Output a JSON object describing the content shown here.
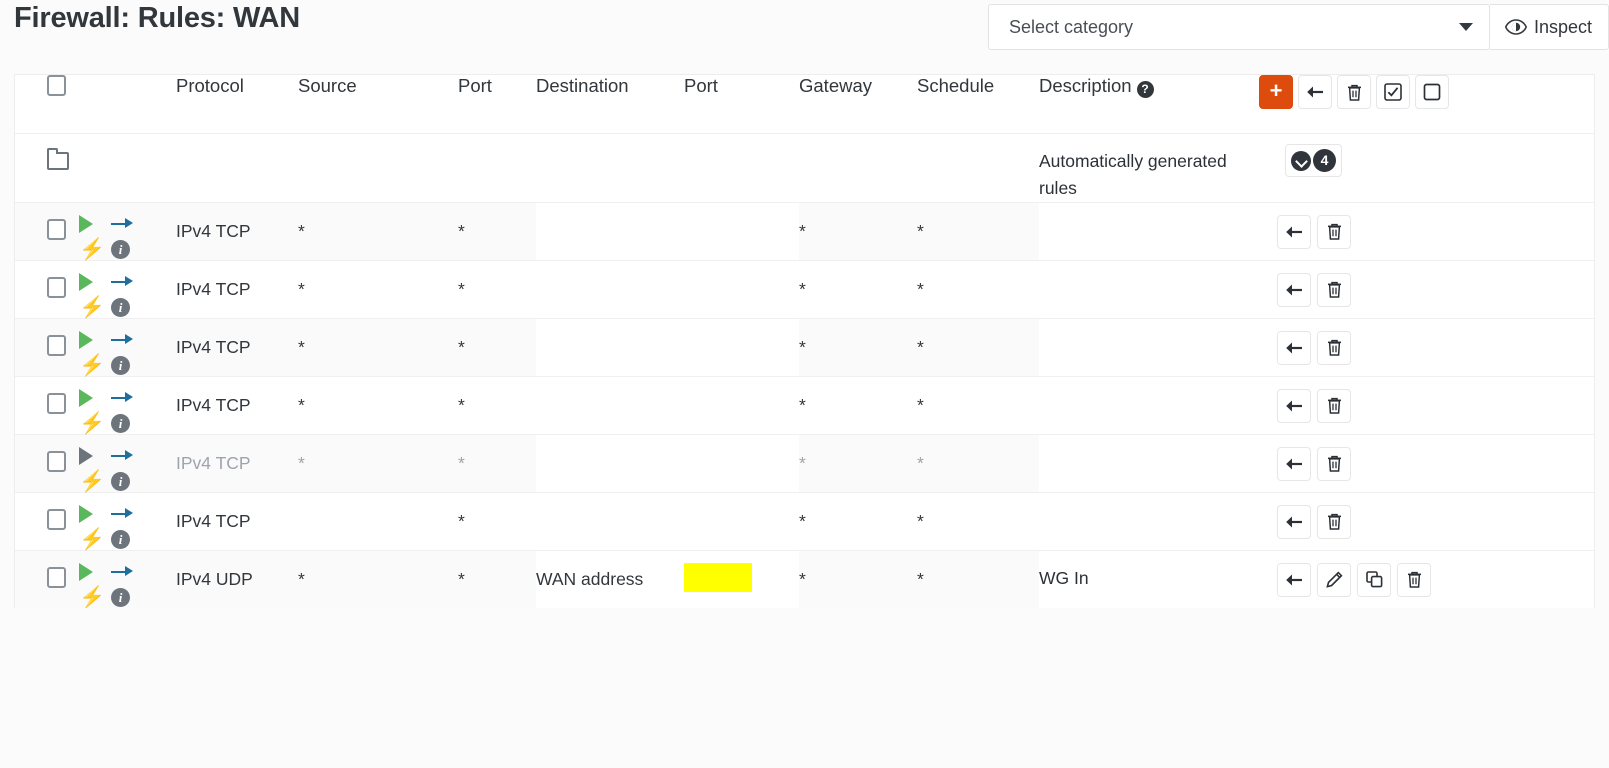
{
  "header": {
    "title": "Firewall: Rules: WAN",
    "category_select": {
      "value": "Select category",
      "placeholder": "Select category"
    },
    "inspect_button": "Inspect"
  },
  "table": {
    "columns": [
      "Protocol",
      "Source",
      "Port",
      "Destination",
      "Port",
      "Gateway",
      "Schedule",
      "Description"
    ],
    "description_help": "?",
    "header_actions": [
      {
        "name": "add-rule-button",
        "glyph": "+"
      },
      {
        "name": "move-rules-button",
        "glyph": "arrow-left"
      },
      {
        "name": "delete-rules-button",
        "glyph": "trash"
      },
      {
        "name": "select-all-button",
        "glyph": "checked-box"
      },
      {
        "name": "deselect-all-button",
        "glyph": "empty-box"
      }
    ],
    "folder_row": {
      "description": "Automatically generated rules",
      "count": "4"
    },
    "rows": [
      {
        "protocol": "IPv4 TCP",
        "source": "*",
        "src_port": "*",
        "destination": "",
        "dst_port": "",
        "gateway": "*",
        "schedule": "*",
        "description": "",
        "enabled": true,
        "highlight_dst_port": false,
        "actions": [
          "move",
          "delete"
        ]
      },
      {
        "protocol": "IPv4 TCP",
        "source": "*",
        "src_port": "*",
        "destination": "",
        "dst_port": "",
        "gateway": "*",
        "schedule": "*",
        "description": "",
        "enabled": true,
        "highlight_dst_port": false,
        "actions": [
          "move",
          "delete"
        ]
      },
      {
        "protocol": "IPv4 TCP",
        "source": "*",
        "src_port": "*",
        "destination": "",
        "dst_port": "",
        "gateway": "*",
        "schedule": "*",
        "description": "",
        "enabled": true,
        "highlight_dst_port": false,
        "actions": [
          "move",
          "delete"
        ]
      },
      {
        "protocol": "IPv4 TCP",
        "source": "*",
        "src_port": "*",
        "destination": "",
        "dst_port": "",
        "gateway": "*",
        "schedule": "*",
        "description": "",
        "enabled": true,
        "highlight_dst_port": false,
        "actions": [
          "move",
          "delete"
        ]
      },
      {
        "protocol": "IPv4 TCP",
        "source": "*",
        "src_port": "*",
        "destination": "",
        "dst_port": "",
        "gateway": "*",
        "schedule": "*",
        "description": "",
        "enabled": false,
        "highlight_dst_port": false,
        "actions": [
          "move",
          "delete"
        ]
      },
      {
        "protocol": "IPv4 TCP",
        "source": "",
        "src_port": "*",
        "destination": "",
        "dst_port": "",
        "gateway": "*",
        "schedule": "*",
        "description": "",
        "enabled": true,
        "highlight_dst_port": false,
        "actions": [
          "move",
          "delete"
        ]
      },
      {
        "protocol": "IPv4 UDP",
        "source": "*",
        "src_port": "*",
        "destination": "WAN address",
        "dst_port": "",
        "gateway": "*",
        "schedule": "*",
        "description": "WG In",
        "enabled": true,
        "highlight_dst_port": true,
        "actions": [
          "move",
          "edit",
          "copy",
          "delete"
        ]
      }
    ]
  },
  "colors": {
    "accent_orange": "#dd4b0d",
    "pass_green": "#5bb75b",
    "direction_blue": "#1f6f9c",
    "bolt_orange": "#f0a030",
    "highlight_yellow": "#ffff00",
    "text": "#32373c",
    "muted_text": "#9ea4ab"
  }
}
